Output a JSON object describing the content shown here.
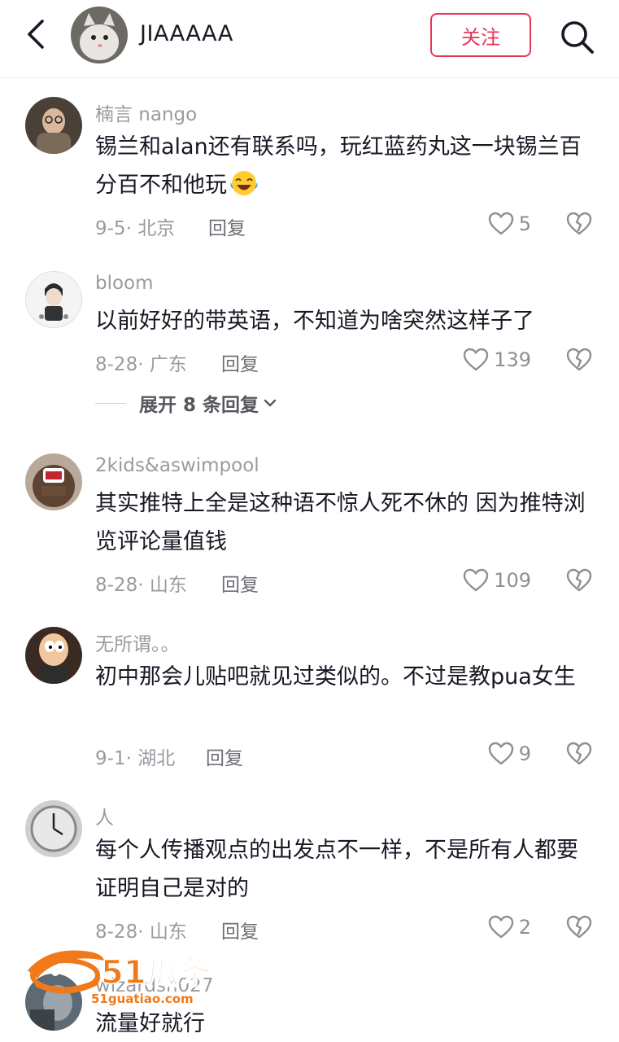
{
  "header": {
    "username": "JIAAAAA",
    "follow_label": "关注"
  },
  "comments": [
    {
      "username": "楠言 nango",
      "text": "锡兰和alan还有联系吗，玩红蓝药丸这一块锡兰百分百不和他玩",
      "emoji": "laughing-crying-emoji",
      "date_location": "9-5· 北京",
      "reply_label": "回复",
      "likes": "5"
    },
    {
      "username": "bloom",
      "text": "以前好好的带英语，不知道为啥突然这样子了",
      "date_location": "8-28· 广东",
      "reply_label": "回复",
      "likes": "139"
    },
    {
      "username": "2kids&aswimpool",
      "text": "其实推特上全是这种语不惊人死不休的 因为推特浏览评论量值钱",
      "date_location": "8-28· 山东",
      "reply_label": "回复",
      "likes": "109"
    },
    {
      "username": "无所谓。。",
      "text": "初中那会儿贴吧就见过类似的。不过是教pua女生",
      "date_location": "9-1· 湖北",
      "reply_label": "回复",
      "likes": "9"
    },
    {
      "username": "人",
      "text": "每个人传播观点的出发点不一样，不是所有人都要证明自己是对的",
      "date_location": "8-28· 山东",
      "reply_label": "回复",
      "likes": "2"
    },
    {
      "username": "wizardsh027",
      "text": "流量好就行"
    }
  ],
  "expand_replies_label": "展开 8 条回复",
  "watermark": {
    "brand": "51瓜条",
    "url": "51guatiao.com"
  },
  "colors": {
    "accent": "#e7355a",
    "secondary_text": "#9a9ba1",
    "watermark": "#f07a1a"
  }
}
